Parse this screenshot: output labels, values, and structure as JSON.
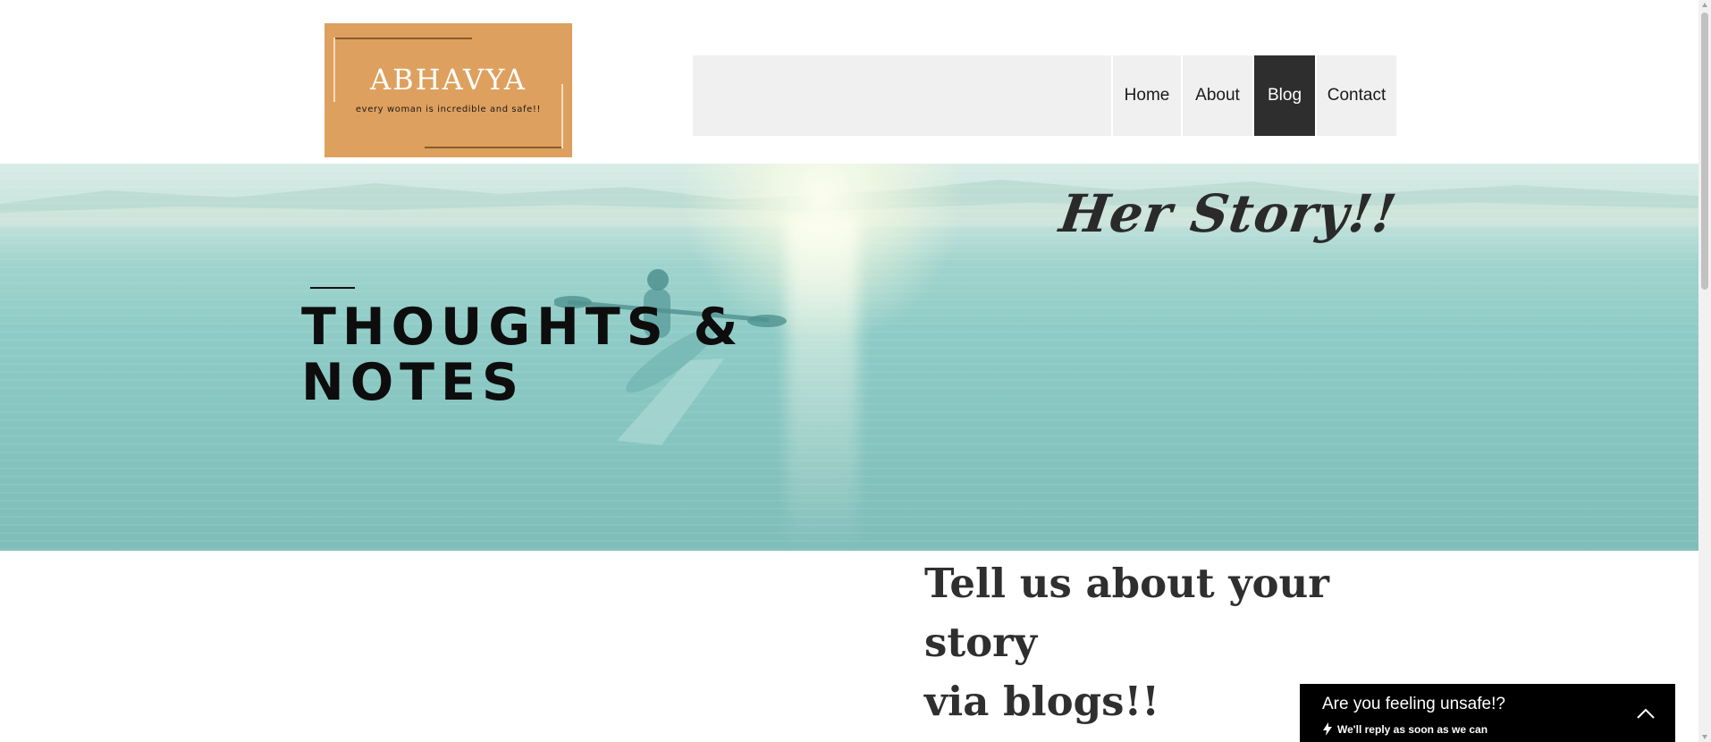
{
  "logo": {
    "name": "ABHAVYA",
    "tagline": "every woman is incredible and safe!!"
  },
  "nav": {
    "items": [
      {
        "label": "Home",
        "active": false
      },
      {
        "label": "About",
        "active": false
      },
      {
        "label": "Blog",
        "active": true
      },
      {
        "label": "Contact",
        "active": false
      }
    ]
  },
  "hero": {
    "heading_line1": "THOUGHTS &",
    "heading_line2": "NOTES",
    "script_title": "Her Story!!"
  },
  "story": {
    "heading_line1": "Tell us about your story",
    "heading_line2": "via blogs!!"
  },
  "chat": {
    "title": "Are you feeling unsafe!?",
    "subtitle": "We'll reply as soon as we can",
    "icon": "lightning-icon",
    "toggle_icon": "chevron-up-icon"
  },
  "colors": {
    "logo_bg": "#dea05e",
    "nav_bg": "#f0f0f0",
    "nav_active_bg": "#2e2e2e",
    "hero_water": "#8ecbc6",
    "chat_bg": "#000000"
  }
}
